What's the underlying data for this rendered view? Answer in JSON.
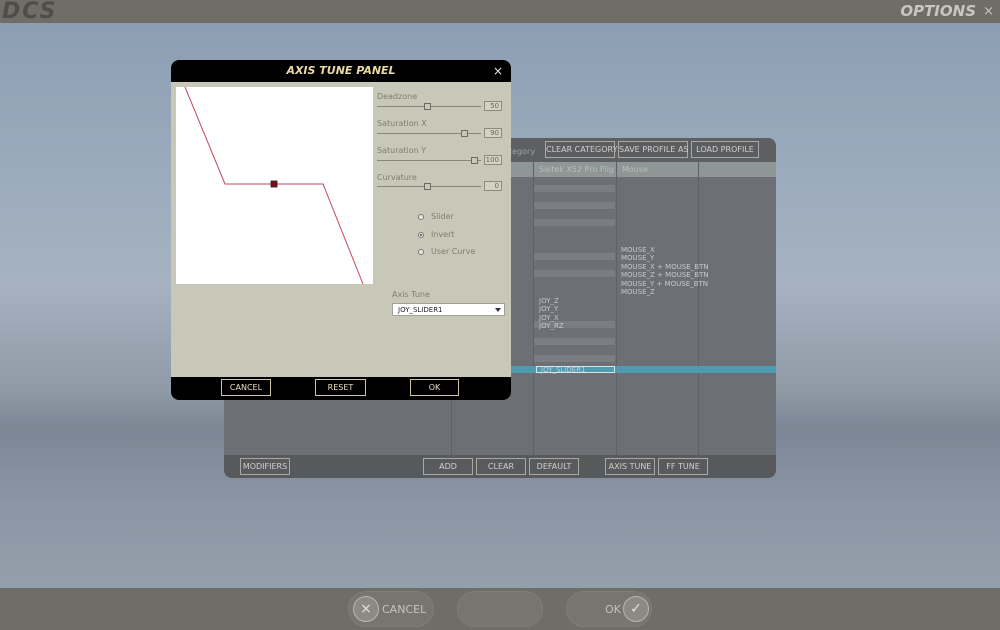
{
  "topbar": {
    "logo": "DCS",
    "title": "OPTIONS",
    "close": "×"
  },
  "bottom": {
    "cancel": "CANCEL",
    "ok": "OK",
    "cancel_icon": "×",
    "ok_icon": "✓"
  },
  "main_panel": {
    "category_fragment": "tegory",
    "toolbar": [
      "CLEAR CATEGORY",
      "SAVE PROFILE AS",
      "LOAD PROFILE"
    ],
    "headers": [
      "Saitek X52 Pro Flig",
      "Mouse"
    ],
    "joy_items": [
      "JOY_Z",
      "JOY_Y",
      "JOY_X",
      "JOY_RZ"
    ],
    "mouse_items": [
      "MOUSE_X",
      "MOUSE_Y",
      "MOUSE_X + MOUSE_BTN",
      "MOUSE_Z + MOUSE_BTN",
      "MOUSE_Y + MOUSE_BTN",
      "MOUSE_Z"
    ],
    "highlight_cell": "JOY_SLIDER1",
    "bottom_buttons": [
      "MODIFIERS",
      "ADD",
      "CLEAR",
      "DEFAULT",
      "AXIS TUNE",
      "FF TUNE"
    ]
  },
  "axis_tune": {
    "title": "AXIS TUNE PANEL",
    "close": "×",
    "params": [
      {
        "label": "Deadzone",
        "value": "50",
        "fraction": 0.5
      },
      {
        "label": "Saturation X",
        "value": "90",
        "fraction": 0.9
      },
      {
        "label": "Saturation Y",
        "value": "100",
        "fraction": 1.0
      },
      {
        "label": "Curvature",
        "value": "0",
        "fraction": 0.5
      }
    ],
    "options": [
      {
        "label": "Slider",
        "checked": false
      },
      {
        "label": "Invert",
        "checked": true
      },
      {
        "label": "User Curve",
        "checked": false
      }
    ],
    "axis_tune_label": "Axis Tune",
    "axis_tune_value": "JOY_SLIDER1",
    "buttons": [
      "CANCEL",
      "RESET",
      "OK"
    ]
  }
}
